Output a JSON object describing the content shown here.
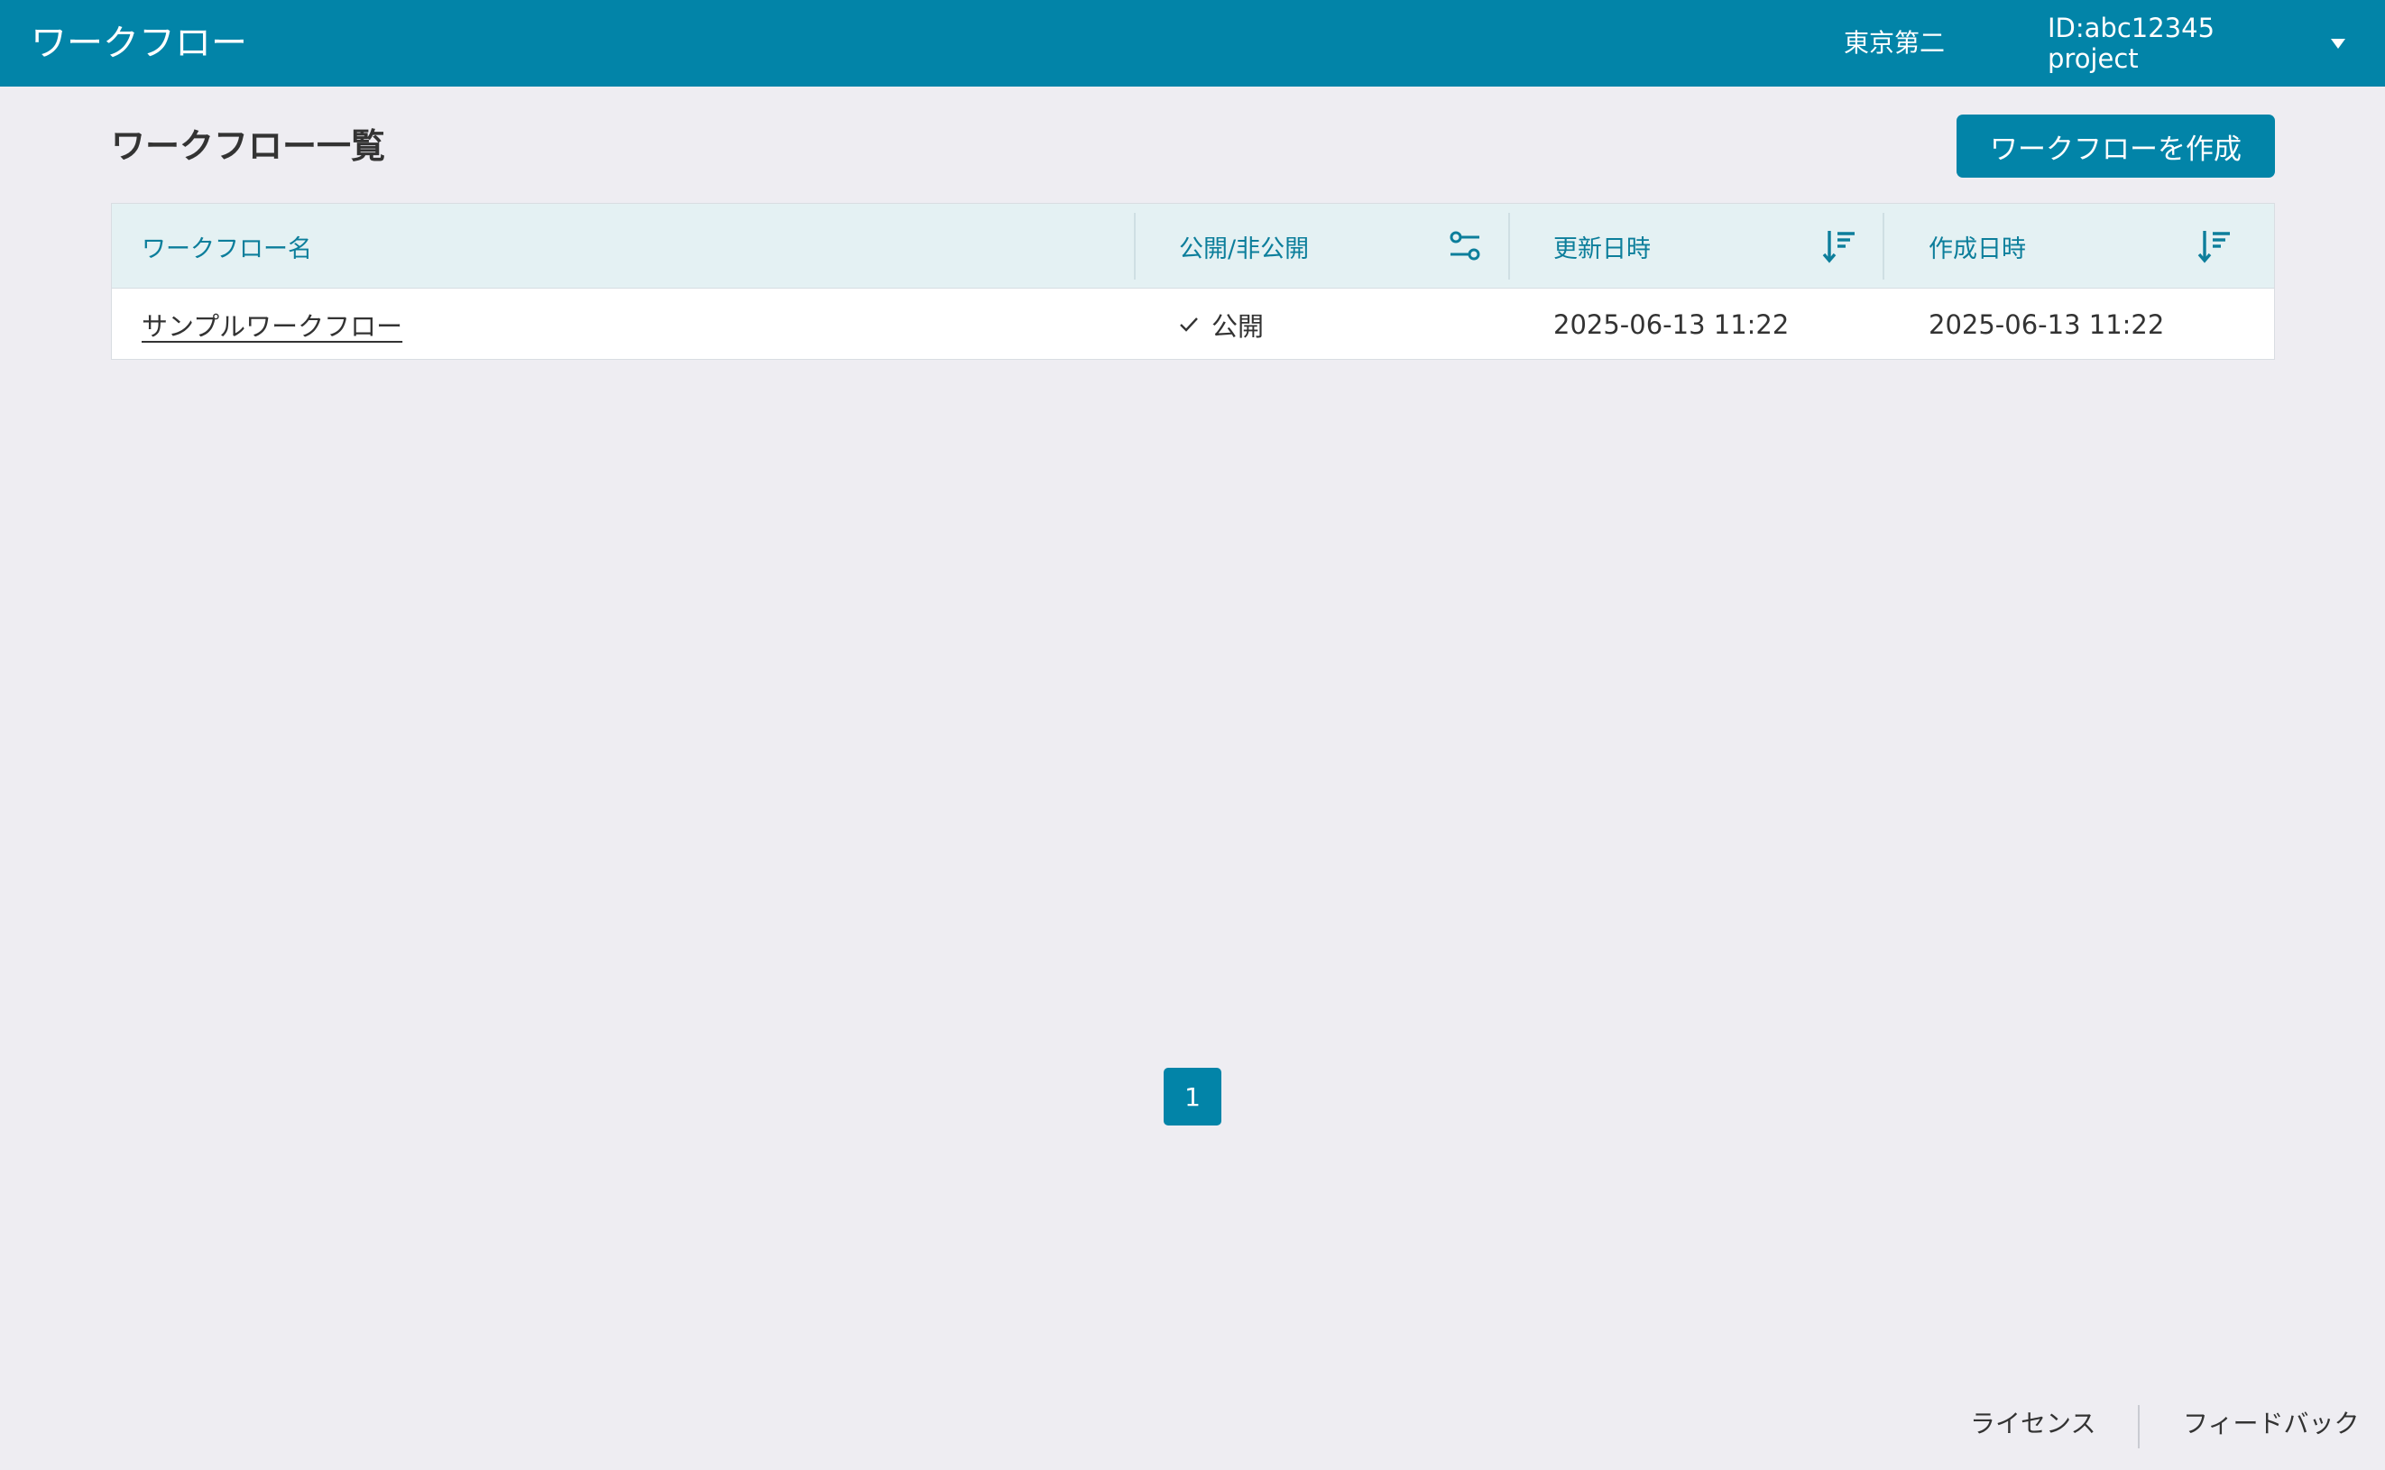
{
  "header": {
    "app_title": "ワークフロー",
    "org_name": "東京第二",
    "project_selector": "ID:abc12345 project"
  },
  "page": {
    "title": "ワークフロー一覧",
    "create_button": "ワークフローを作成"
  },
  "table": {
    "columns": [
      {
        "label": "ワークフロー名",
        "icon": null
      },
      {
        "label": "公開/非公開",
        "icon": "filter-icon"
      },
      {
        "label": "更新日時",
        "icon": "sort-descending-icon"
      },
      {
        "label": "作成日時",
        "icon": "sort-descending-icon"
      }
    ],
    "rows": [
      {
        "name": "サンプルワークフロー",
        "visibility": "公開",
        "updated_at": "2025-06-13 11:22",
        "created_at": "2025-06-13 11:22"
      }
    ]
  },
  "pagination": {
    "current_page": "1"
  },
  "footer": {
    "license": "ライセンス",
    "feedback": "フィードバック"
  },
  "colors": {
    "brand": "#0284a8",
    "header_row": "#e4f1f3",
    "background": "#eeedf2"
  }
}
